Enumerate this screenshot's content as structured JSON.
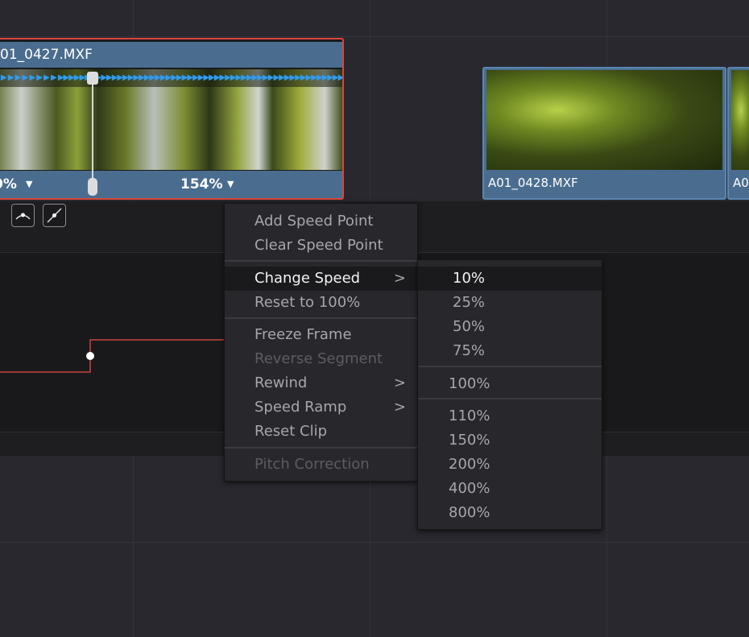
{
  "clips": [
    {
      "name": "01_0427.MXF",
      "speed_left": "0%",
      "speed_right": "154%",
      "selected": true
    },
    {
      "name": "A01_0428.MXF"
    },
    {
      "name": "A0"
    }
  ],
  "colors": {
    "clip_bar": "#4a6d8f",
    "selection_border": "#d9473b",
    "speed_arrows": "#2e9cf0",
    "curve": "#d9473b"
  },
  "toolbar": {
    "buttons": [
      "ease-curve-icon",
      "linear-curve-icon"
    ]
  },
  "context_menu": {
    "items": [
      {
        "label": "Add Speed Point",
        "enabled": true
      },
      {
        "label": "Clear Speed Point",
        "enabled": true
      },
      {
        "label": "Change Speed",
        "enabled": true,
        "submenu": true,
        "highlighted": true
      },
      {
        "label": "Reset to 100%",
        "enabled": true
      },
      {
        "label": "Freeze Frame",
        "enabled": true
      },
      {
        "label": "Reverse Segment",
        "enabled": false
      },
      {
        "label": "Rewind",
        "enabled": true,
        "submenu": true
      },
      {
        "label": "Speed Ramp",
        "enabled": true,
        "submenu": true
      },
      {
        "label": "Reset Clip",
        "enabled": true
      },
      {
        "label": "Pitch Correction",
        "enabled": false
      }
    ],
    "chevron": ">"
  },
  "speed_submenu": {
    "items": [
      "10%",
      "25%",
      "50%",
      "75%",
      "100%",
      "110%",
      "150%",
      "200%",
      "400%",
      "800%"
    ],
    "highlighted": "10%"
  }
}
